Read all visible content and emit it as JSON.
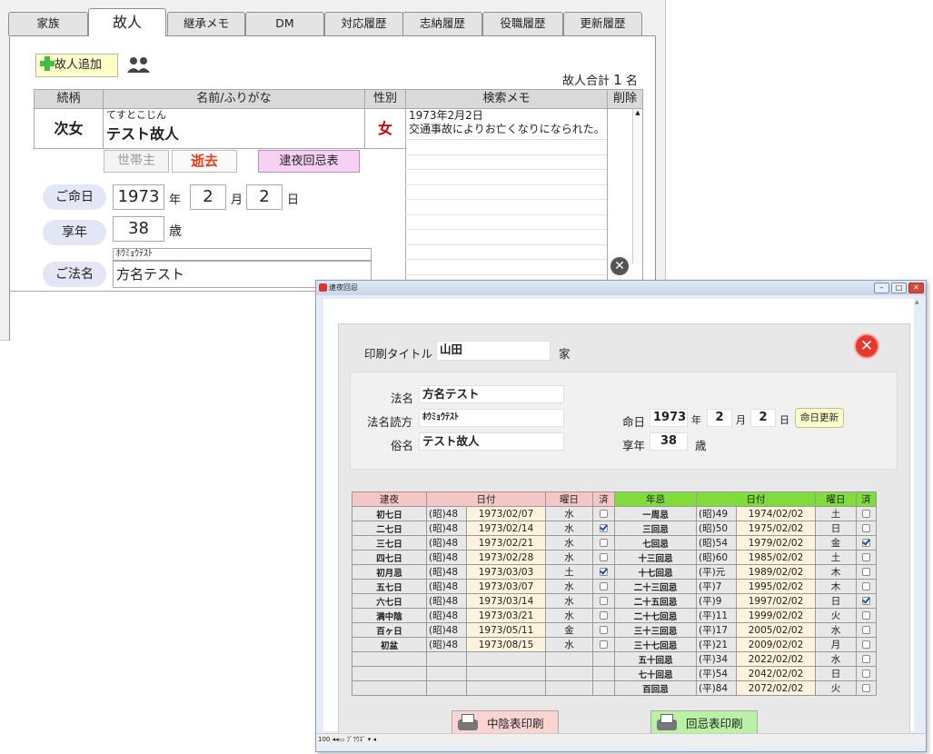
{
  "tabs": [
    "家族",
    "故人",
    "継承メモ",
    "DM",
    "対応履歴",
    "志納履歴",
    "役職履歴",
    "更新履歴"
  ],
  "add_button": "故人追加",
  "total": {
    "label": "故人合計",
    "count": "1",
    "unit": "名"
  },
  "headers": {
    "relation": "続柄",
    "name": "名前/ふりがな",
    "gender": "性別",
    "memo": "検索メモ",
    "delete": "削除"
  },
  "person": {
    "relation": "次女",
    "furigana": "てすとこじん",
    "name": "テスト故人",
    "gender": "女",
    "btn_head": "世帯主",
    "btn_dead": "逝去",
    "btn_table": "逮夜回忌表",
    "death_label": "ご命日",
    "year": "1973",
    "year_unit": "年",
    "month": "2",
    "month_unit": "月",
    "day": "2",
    "day_unit": "日",
    "age_label": "享年",
    "age": "38",
    "age_unit": "歳",
    "dharma_label": "ご法名",
    "dharma_kana": "ﾎｳﾐｮｳﾃｽﾄ",
    "dharma": "方名テスト",
    "memo": [
      "1973年2月2日",
      "交通事故によりお亡くなりになられた。"
    ]
  },
  "popup": {
    "title": "逮夜回忌",
    "print_title_label": "印刷タイトル",
    "print_title": "山田",
    "print_title_suffix": "家",
    "hougo_label": "法名",
    "hougo": "方名テスト",
    "hougo_kana_label": "法名読方",
    "hougo_kana": "ﾎｳﾐｮｳﾃｽﾄ",
    "zokumyo_label": "俗名",
    "zokumyo": "テスト故人",
    "meinichi_label": "命日",
    "y": "1973",
    "y_unit": "年",
    "m": "2",
    "m_unit": "月",
    "d": "2",
    "d_unit": "日",
    "update_button": "命日更新",
    "kyonen_label": "享年",
    "kyonen": "38",
    "kyonen_unit": "歳",
    "left_headers": [
      "逮夜",
      "日付",
      "曜日",
      "済"
    ],
    "right_headers": [
      "年忌",
      "日付",
      "曜日",
      "済"
    ],
    "taiya_rows": [
      [
        "初七日",
        "(昭)48",
        "1973/02/07",
        "水",
        false
      ],
      [
        "二七日",
        "(昭)48",
        "1973/02/14",
        "水",
        true
      ],
      [
        "三七日",
        "(昭)48",
        "1973/02/21",
        "水",
        false
      ],
      [
        "四七日",
        "(昭)48",
        "1973/02/28",
        "水",
        false
      ],
      [
        "初月忌",
        "(昭)48",
        "1973/03/03",
        "土",
        true
      ],
      [
        "五七日",
        "(昭)48",
        "1973/03/07",
        "水",
        false
      ],
      [
        "六七日",
        "(昭)48",
        "1973/03/14",
        "水",
        false
      ],
      [
        "満中陰",
        "(昭)48",
        "1973/03/21",
        "水",
        false
      ],
      [
        "百ヶ日",
        "(昭)48",
        "1973/05/11",
        "金",
        false
      ],
      [
        "初盆",
        "(昭)48",
        "1973/08/15",
        "水",
        false
      ]
    ],
    "nenki_rows": [
      [
        "一周忌",
        "(昭)49",
        "1974/02/02",
        "土",
        false
      ],
      [
        "三回忌",
        "(昭)50",
        "1975/02/02",
        "日",
        false
      ],
      [
        "七回忌",
        "(昭)54",
        "1979/02/02",
        "金",
        true
      ],
      [
        "十三回忌",
        "(昭)60",
        "1985/02/02",
        "土",
        false
      ],
      [
        "十七回忌",
        "(平)元",
        "1989/02/02",
        "木",
        false
      ],
      [
        "二十三回忌",
        "(平)7",
        "1995/02/02",
        "木",
        false
      ],
      [
        "二十五回忌",
        "(平)9",
        "1997/02/02",
        "日",
        true
      ],
      [
        "二十七回忌",
        "(平)11",
        "1999/02/02",
        "火",
        false
      ],
      [
        "三十三回忌",
        "(平)17",
        "2005/02/02",
        "水",
        false
      ],
      [
        "三十七回忌",
        "(平)21",
        "2009/02/02",
        "月",
        false
      ],
      [
        "五十回忌",
        "(平)34",
        "2022/02/02",
        "水",
        false
      ],
      [
        "七十回忌",
        "(平)54",
        "2042/02/02",
        "日",
        false
      ],
      [
        "百回忌",
        "(平)84",
        "2072/02/02",
        "火",
        false
      ]
    ],
    "btn_chuin": "中陰表印刷",
    "btn_kaiki": "回忌表印刷",
    "statusbar": {
      "zoom": "100",
      "mode": "ﾌﾞﾗｳｽﾞ"
    }
  },
  "colors": {
    "taiya_header": "#f4c6c6",
    "nenki_header": "#7fdc3a",
    "date_cell": "#fdf3dc",
    "close_red": "#e8372b"
  }
}
